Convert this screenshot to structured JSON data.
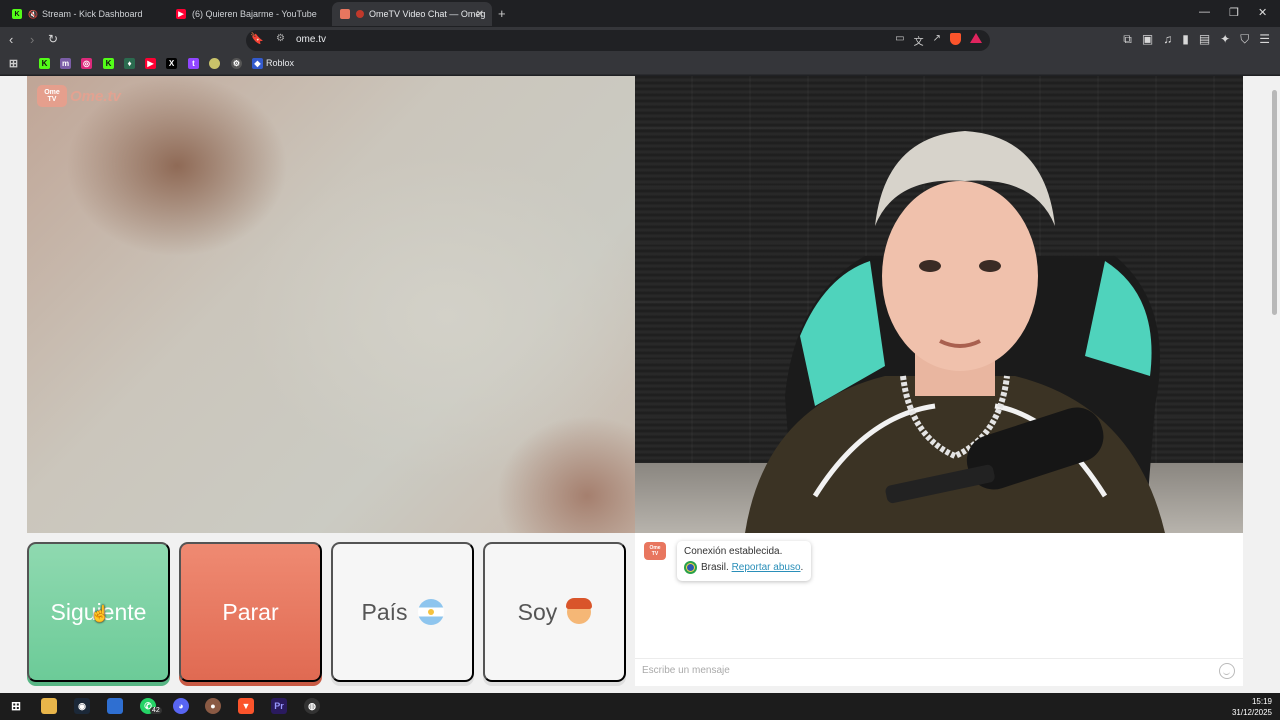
{
  "browser": {
    "tabs": [
      {
        "title": "Stream - Kick Dashboard",
        "fav_color": "#53fc18",
        "fav_text": "K",
        "muted": true
      },
      {
        "title": "(6) Quieren Bajarme - YouTube",
        "fav_color": "#ff0033",
        "fav_text": "▶",
        "muted": false
      },
      {
        "title": "OmeTV Video Chat — Omeg",
        "fav_color": "#e8765f",
        "fav_text": "",
        "muted": false
      }
    ],
    "new_tab": "+",
    "url": "ome.tv",
    "bookmarks_label": "Roblox"
  },
  "page": {
    "logo_badge": "Ome\nTV",
    "logo_text": "Ome.tv",
    "buttons": {
      "next": "Siguiente",
      "stop": "Parar",
      "country": "País",
      "gender": "Soy"
    },
    "chat": {
      "logo_badge": "Ome\nTV",
      "status": "Conexión establecida.",
      "country": "Brasil.",
      "report": "Reportar abuso",
      "report_suffix": ".",
      "input_placeholder": "Escribe un mensaje"
    }
  },
  "taskbar": {
    "whatsapp_badge": "42",
    "time": "15:19",
    "date": "31/12/2025"
  }
}
